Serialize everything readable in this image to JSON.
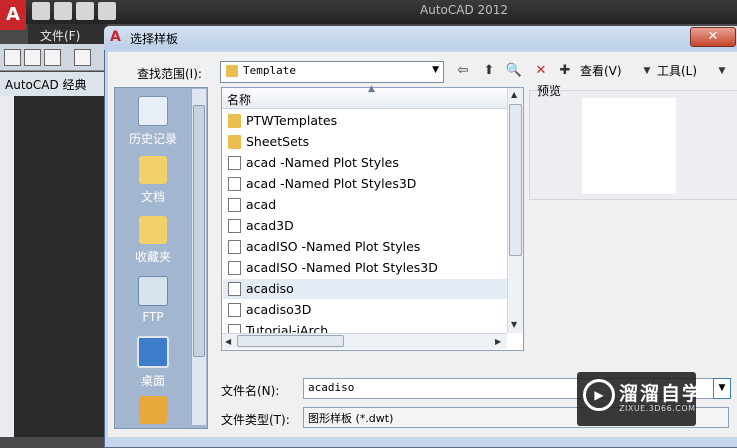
{
  "app": {
    "window_title": "AutoCAD 2012",
    "menu_file": "文件(F)",
    "workspace": "AutoCAD 经典"
  },
  "dialog": {
    "title": "选择样板",
    "look_in_label": "查找范围(I):",
    "look_in_value": "Template",
    "views_label": "查看(V)",
    "tools_label": "工具(L)",
    "column_name": "名称",
    "preview_label": "预览",
    "file_name_label": "文件名(N):",
    "file_name_value": "acadiso",
    "file_type_label": "文件类型(T):",
    "file_type_value": "图形样板 (*.dwt)",
    "places": [
      {
        "label": "历史记录",
        "icon": "history-icon"
      },
      {
        "label": "文档",
        "icon": "documents-icon"
      },
      {
        "label": "收藏夹",
        "icon": "favorites-icon"
      },
      {
        "label": "FTP",
        "icon": "ftp-icon"
      },
      {
        "label": "桌面",
        "icon": "desktop-icon"
      },
      {
        "label": "",
        "icon": "folder-icon"
      }
    ],
    "files": [
      {
        "name": "PTWTemplates",
        "type": "folder"
      },
      {
        "name": "SheetSets",
        "type": "folder"
      },
      {
        "name": "acad -Named Plot Styles",
        "type": "dwt"
      },
      {
        "name": "acad -Named Plot Styles3D",
        "type": "dwt"
      },
      {
        "name": "acad",
        "type": "dwt"
      },
      {
        "name": "acad3D",
        "type": "dwt"
      },
      {
        "name": "acadISO -Named Plot Styles",
        "type": "dwt"
      },
      {
        "name": "acadISO -Named Plot Styles3D",
        "type": "dwt"
      },
      {
        "name": "acadiso",
        "type": "dwt",
        "selected": true
      },
      {
        "name": "acadiso3D",
        "type": "dwt"
      },
      {
        "name": "Tutorial-iArch",
        "type": "dwt"
      }
    ]
  },
  "watermark": {
    "text": "溜溜自学",
    "sub": "ZIXUE.3D66.COM"
  }
}
